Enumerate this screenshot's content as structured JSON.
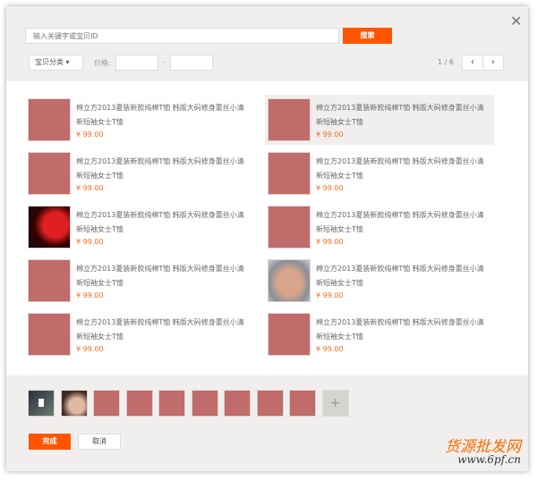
{
  "header": {
    "search_placeholder": "输入关键字或宝贝ID",
    "search_label": "搜索",
    "category_label": "宝贝分类 ▾",
    "price_label": "价格:",
    "price_dash": "-",
    "page_indicator": "1 / 6",
    "prev": "‹",
    "next": "›",
    "close": "✕"
  },
  "items": [
    {
      "title": "棉立方2013夏装新款纯棉T恤 韩版大码修身蕾丝小清新短袖女士T恤",
      "price": "¥ 99.00",
      "thumb": "placeholder"
    },
    {
      "title": "棉立方2013夏装新款纯棉T恤 韩版大码修身蕾丝小清新短袖女士T恤",
      "price": "¥ 99.00",
      "thumb": "placeholder",
      "selected": true
    },
    {
      "title": "棉立方2013夏装新款纯棉T恤 韩版大码修身蕾丝小清新短袖女士T恤",
      "price": "¥ 99.00",
      "thumb": "placeholder"
    },
    {
      "title": "棉立方2013夏装新款纯棉T恤 韩版大码修身蕾丝小清新短袖女士T恤",
      "price": "¥ 99.00",
      "thumb": "placeholder"
    },
    {
      "title": "棉立方2013夏装新款纯棉T恤 韩版大码修身蕾丝小清新短袖女士T恤",
      "price": "¥ 99.00",
      "thumb": "photo-red"
    },
    {
      "title": "棉立方2013夏装新款纯棉T恤 韩版大码修身蕾丝小清新短袖女士T恤",
      "price": "¥ 99.00",
      "thumb": "placeholder"
    },
    {
      "title": "棉立方2013夏装新款纯棉T恤 韩版大码修身蕾丝小清新短袖女士T恤",
      "price": "¥ 99.00",
      "thumb": "placeholder"
    },
    {
      "title": "棉立方2013夏装新款纯棉T恤 韩版大码修身蕾丝小清新短袖女士T恤",
      "price": "¥ 99.00",
      "thumb": "photo-man"
    },
    {
      "title": "棉立方2013夏装新款纯棉T恤 韩版大码修身蕾丝小清新短袖女士T恤",
      "price": "¥ 99.00",
      "thumb": "placeholder"
    },
    {
      "title": "棉立方2013夏装新款纯棉T恤 韩版大码修身蕾丝小清新短袖女士T恤",
      "price": "¥ 99.00",
      "thumb": "placeholder"
    }
  ],
  "footer": {
    "add_label": "+",
    "done_label": "完成",
    "cancel_label": "取消",
    "selected_count": 9
  },
  "watermark": {
    "line1": "货源批发网",
    "line2": "www.6pf.cn"
  },
  "colors": {
    "accent": "#ff5500",
    "placeholder": "#c06c6a"
  }
}
